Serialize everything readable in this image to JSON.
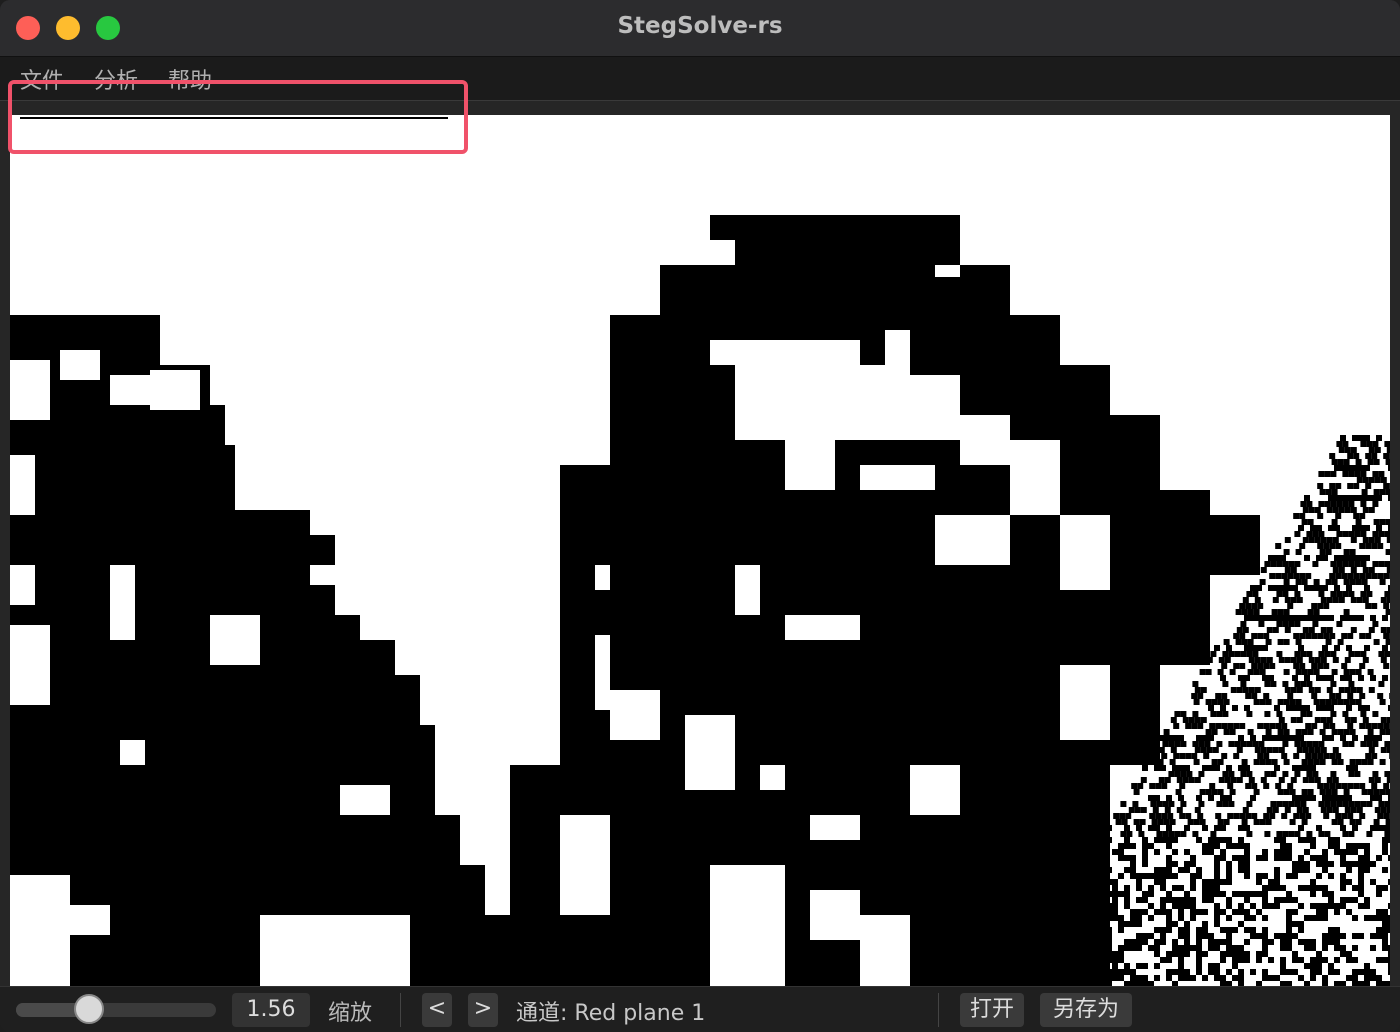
{
  "window": {
    "title": "StegSolve-rs"
  },
  "menu": {
    "items": [
      "文件",
      "分析",
      "帮助"
    ]
  },
  "image_view": {
    "description": "bit plane black/white image preview"
  },
  "statusbar": {
    "zoom_value": "1.56",
    "zoom_label": "缩放",
    "zoom_slider_level": 0.34,
    "prev_label": "<",
    "next_label": ">",
    "channel_text": "通道: Red plane 1",
    "open_label": "打开",
    "save_as_label": "另存为"
  },
  "colors": {
    "highlight_border": "#f0526a",
    "canvas_bg": "#ffffff",
    "pixels": "#000000"
  }
}
